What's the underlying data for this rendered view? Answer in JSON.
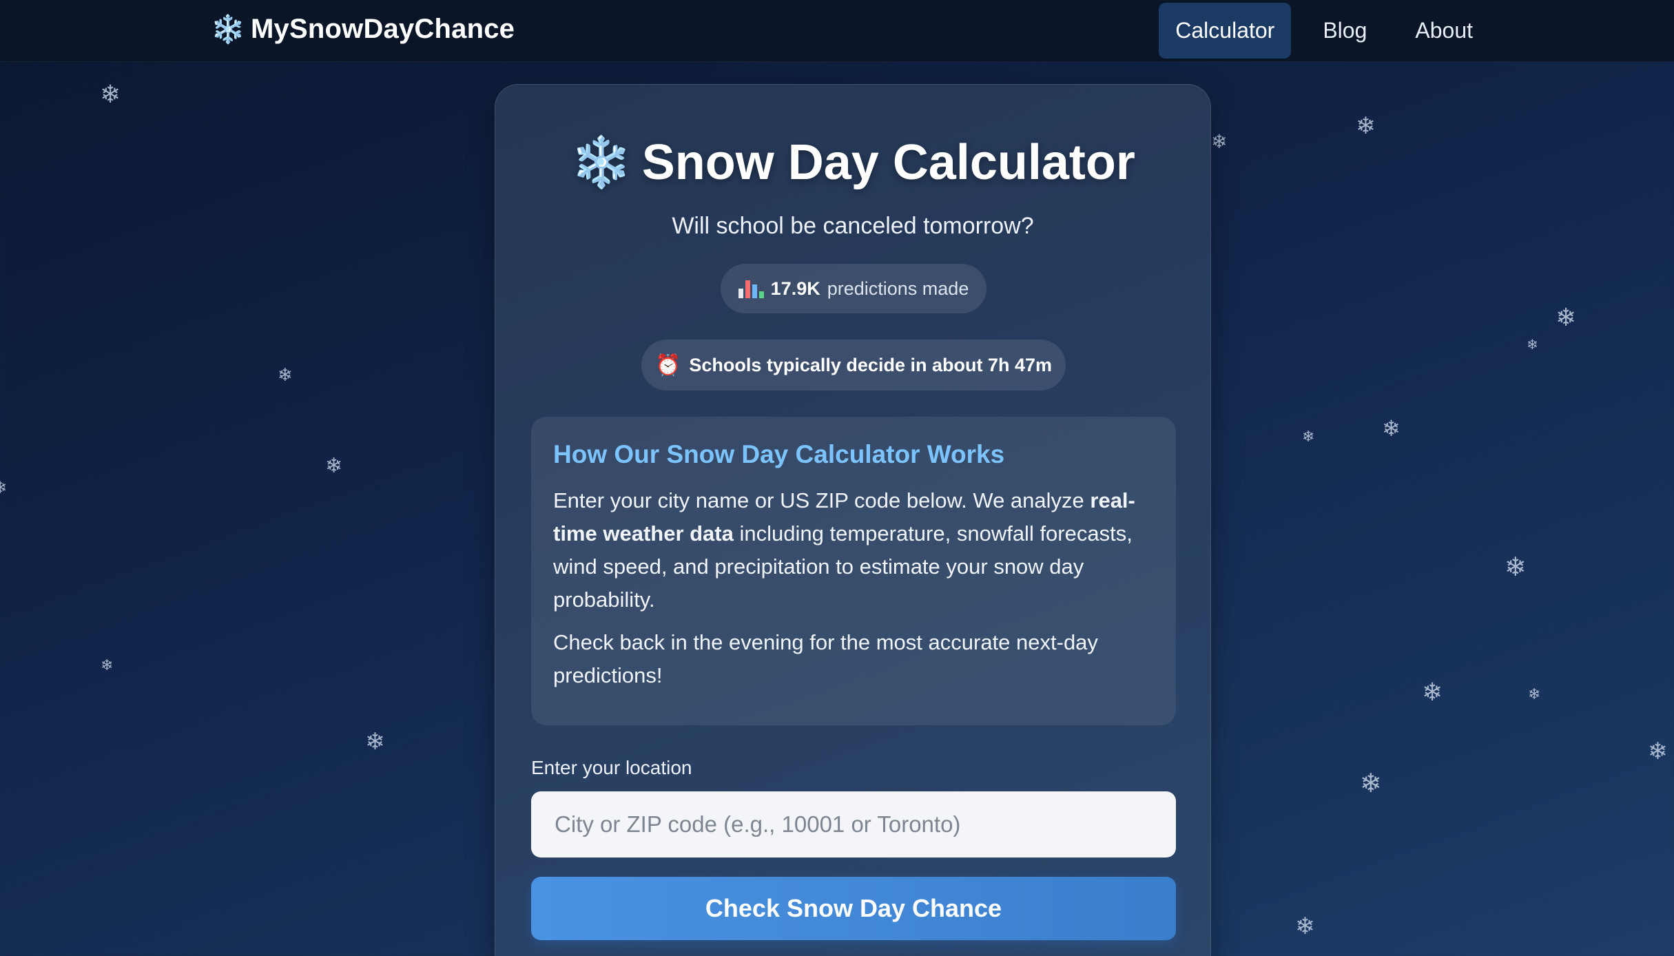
{
  "nav": {
    "brand_icon": "❄️",
    "brand": "MySnowDayChance",
    "links": [
      {
        "label": "Calculator",
        "active": true
      },
      {
        "label": "Blog",
        "active": false
      },
      {
        "label": "About",
        "active": false
      }
    ]
  },
  "card": {
    "title_icon": "❄️",
    "title": "Snow Day Calculator",
    "subtitle": "Will school be canceled tomorrow?",
    "stats": {
      "icon": "bar-chart-icon",
      "count": "17.9K",
      "label": "predictions made"
    },
    "deadline": {
      "icon": "⏰",
      "text": "Schools typically decide in about 7h 47m"
    },
    "info": {
      "title": "How Our Snow Day Calculator Works",
      "p1_before": "Enter your city name or US ZIP code below. We analyze ",
      "p1_bold": "real-time weather data",
      "p1_after": " including temperature, snowfall forecasts, wind speed, and precipitation to estimate your snow day probability.",
      "p2": "Check back in the evening for the most accurate next-day predictions!"
    },
    "location_label": "Enter your location",
    "location_placeholder": "City or ZIP code (e.g., 10001 or Toronto)",
    "location_value": "",
    "check_button": "Check Snow Day Chance"
  },
  "colors": {
    "accent": "#7cc4ff",
    "button": "#4a92e2",
    "nav_bg": "#0a1528",
    "nav_active": "#1b3a64"
  }
}
